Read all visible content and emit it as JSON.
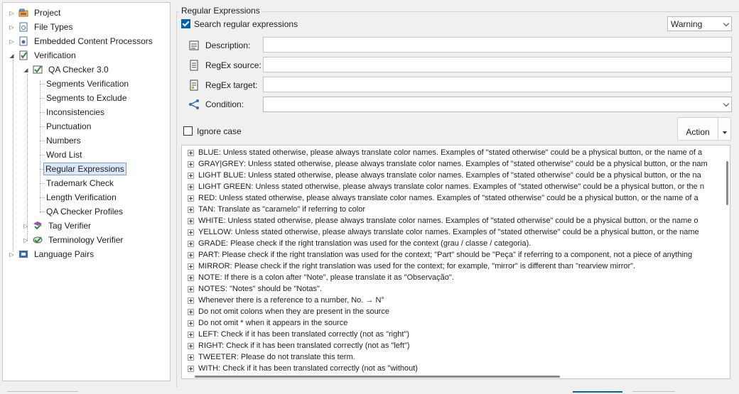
{
  "tree": {
    "items": [
      {
        "label": "Project",
        "icon": "project-icon"
      },
      {
        "label": "File Types",
        "icon": "file-types-icon"
      },
      {
        "label": "Embedded Content Processors",
        "icon": "embedded-content-icon"
      },
      {
        "label": "Verification",
        "icon": "verification-icon"
      },
      {
        "label": "QA Checker 3.0",
        "icon": "qa-checker-icon"
      },
      {
        "label": "Segments Verification"
      },
      {
        "label": "Segments to Exclude"
      },
      {
        "label": "Inconsistencies"
      },
      {
        "label": "Punctuation"
      },
      {
        "label": "Numbers"
      },
      {
        "label": "Word List"
      },
      {
        "label": "Regular Expressions",
        "selected": true
      },
      {
        "label": "Trademark Check"
      },
      {
        "label": "Length Verification"
      },
      {
        "label": "QA Checker Profiles"
      },
      {
        "label": "Tag Verifier",
        "icon": "tag-verifier-icon"
      },
      {
        "label": "Terminology Verifier",
        "icon": "terminology-verifier-icon"
      },
      {
        "label": "Language Pairs",
        "icon": "language-pairs-icon"
      }
    ]
  },
  "panel": {
    "group_title": "Regular Expressions",
    "search_regex_label": "Search regular expressions",
    "search_regex_checked": true,
    "severity": "Warning",
    "description_label": "Description:",
    "description_value": "",
    "regex_source_label": "RegEx source:",
    "regex_source_value": "",
    "regex_target_label": "RegEx target:",
    "regex_target_value": "",
    "condition_label": "Condition:",
    "condition_value": "",
    "ignore_case_label": "Ignore case",
    "ignore_case_checked": false,
    "action_label": "Action"
  },
  "rules": [
    "BLUE: Unless stated otherwise, please always translate color names. Examples of \"stated otherwise\" could be a physical button, or the name of a",
    "GRAY|GREY: Unless stated otherwise, please always translate color names. Examples of \"stated otherwise\" could be a physical button, or the nam",
    "LIGHT BLUE: Unless stated otherwise, please always translate color names. Examples of \"stated otherwise\" could be a physical button, or the na",
    "LIGHT GREEN: Unless stated otherwise, please always translate color names. Examples of \"stated otherwise\" could be a physical button, or the n",
    "RED: Unless stated otherwise, please always translate color names. Examples of \"stated otherwise\" could be a physical button, or the name of a",
    "TAN: Translate as \"caramelo\" if referring to color",
    "WHITE: Unless stated otherwise, please always translate color names. Examples of \"stated otherwise\" could be a physical button, or the name o",
    "YELLOW: Unless stated otherwise, please always translate color names. Examples of \"stated otherwise\" could be a physical button, or the name",
    "GRADE: Please check if the right translation was used for the context (grau / classe / categoria).",
    "PART: Please check if the right translation was used for the context; \"Part\" should be \"Peça\" if referring to a component, not a piece of anything",
    "MIRROR: Please check if the right translation was used for the context; for example, \"mirror\" is different than \"rearview mirror\".",
    "NOTE: If there is a colon after \"Note\", please translate it as \"Observação\".",
    "NOTES: \"Notes\" should be \"Notas\".",
    "Whenever there is a reference to a number, No. → N°",
    "Do not omit colons when they are present in the source",
    "Do not omit * when it appears in the source",
    "LEFT: Check if it has been translated correctly (not as \"right\")",
    "RIGHT: Check if it has been translated correctly (not as \"left\")",
    "TWEETER: Please do not translate this term.",
    "WITH: Check if it has been translated correctly (not as \"without)"
  ],
  "colors": {
    "accent": "#0063b1",
    "selection_bg": "#dbe8f6",
    "selection_border": "#7da2ce"
  }
}
